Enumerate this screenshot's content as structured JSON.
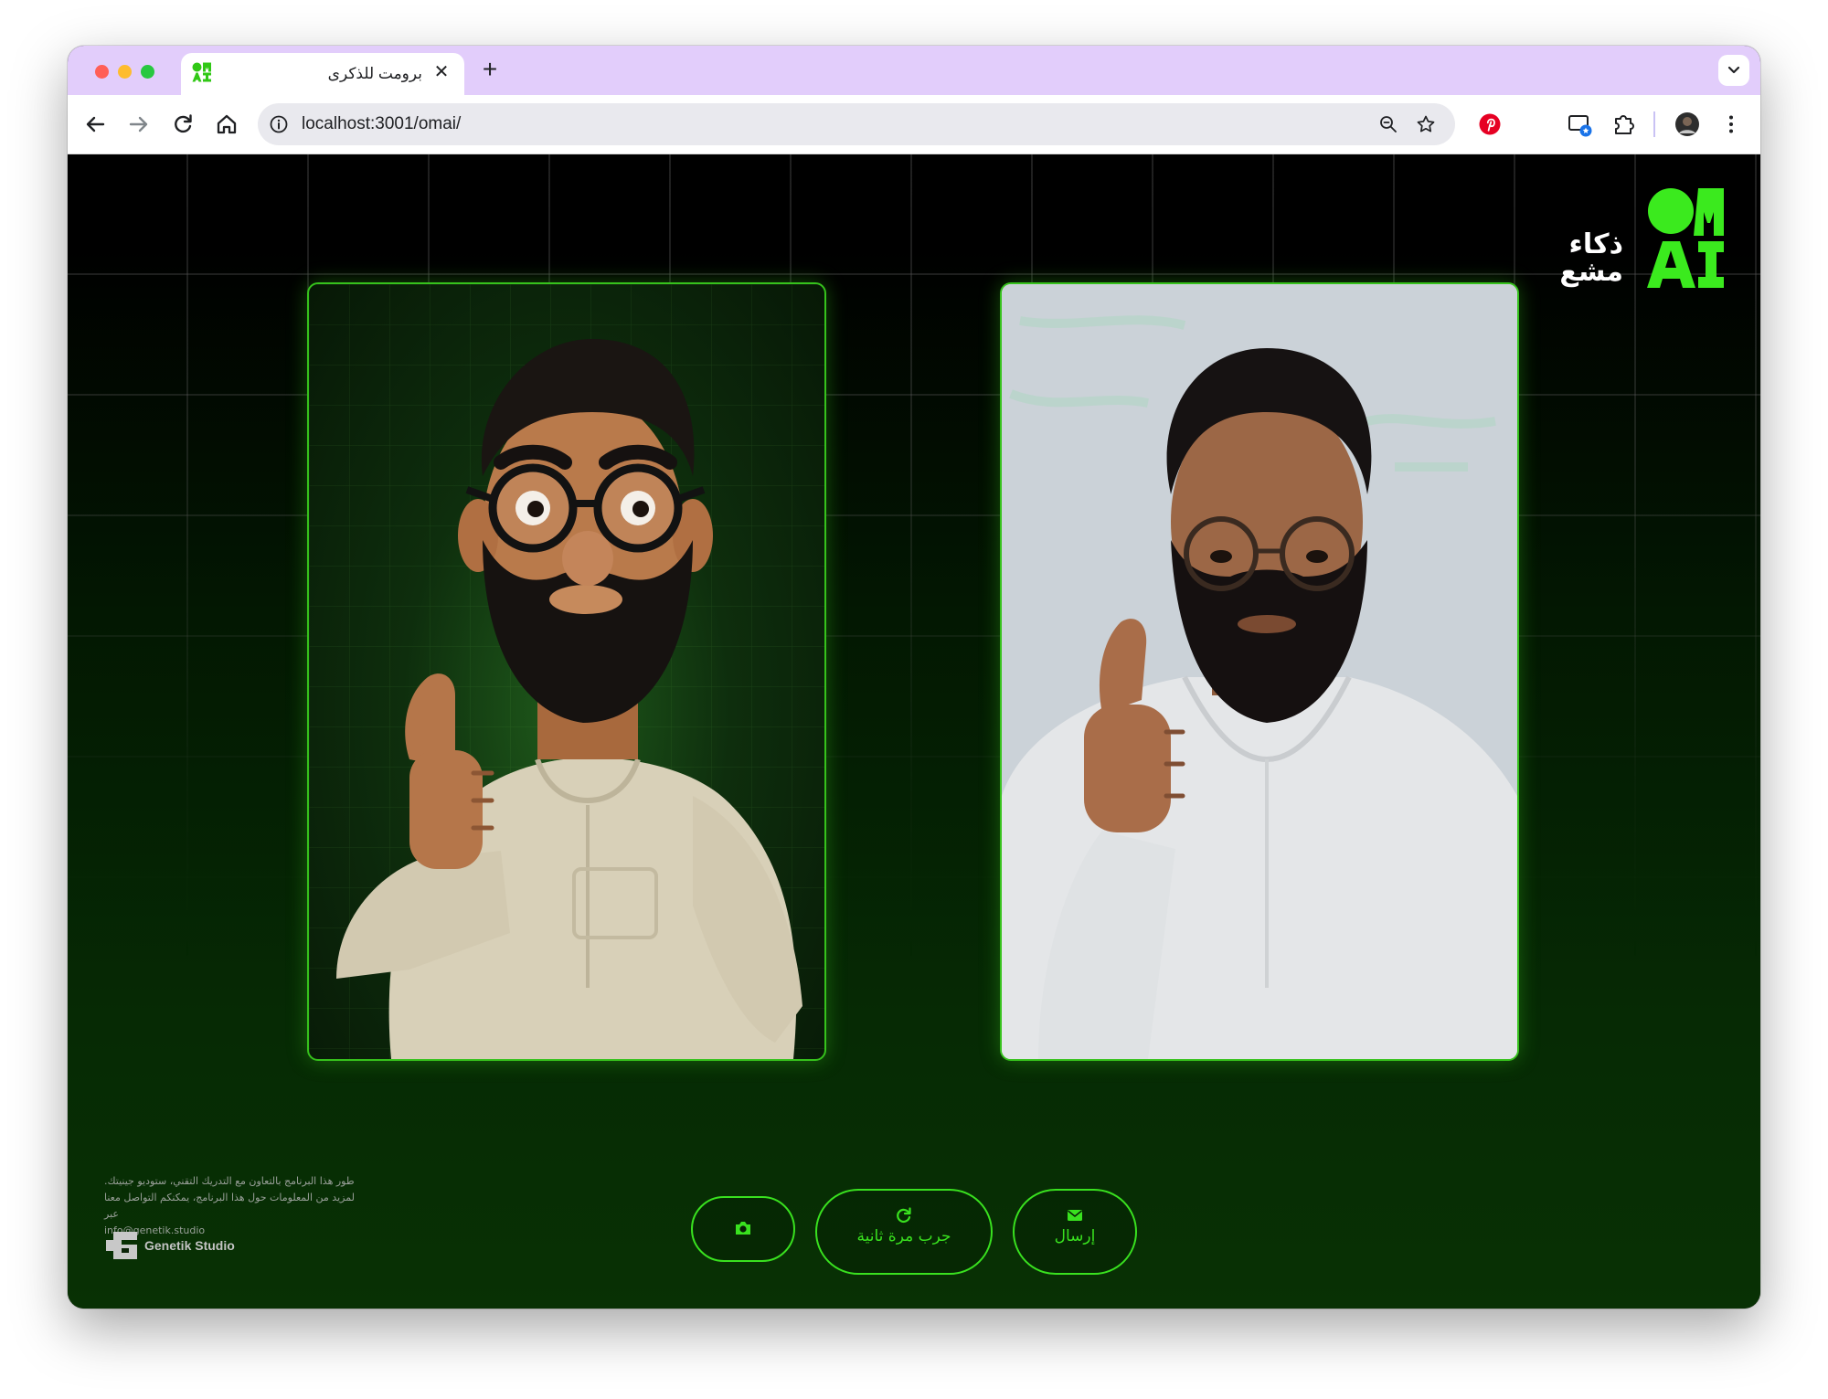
{
  "browser": {
    "tab_title": "برومت للذكرى",
    "tab_close": "✕",
    "new_tab": "+",
    "url": "localhost:3001/omai/",
    "accent": "#e2cdfb"
  },
  "logo": {
    "latin_top": "OM",
    "latin_bottom": "AI",
    "arabic_line1": "ذكاء",
    "arabic_line2": "مشع",
    "color": "#3bea1e"
  },
  "credits": {
    "line1": "طور هذا البرنامج بالتعاون مع التدريك التقني، ستوديو جينيتك.",
    "line2": "لمزيد من المعلومات حول هذا البرنامج، يمكنكم التواصل معنا عبر",
    "email": "info@genetik.studio",
    "studio_name": "Genetik Studio"
  },
  "actions": {
    "camera_icon": "camera-icon",
    "retry_label": "جرب مرة ثانية",
    "retry_icon": "refresh-icon",
    "send_label": "إرسال",
    "send_icon": "envelope-icon",
    "accent": "#39e11f"
  },
  "cards": {
    "left": "avatar-result-image",
    "right": "camera-photo-image"
  }
}
